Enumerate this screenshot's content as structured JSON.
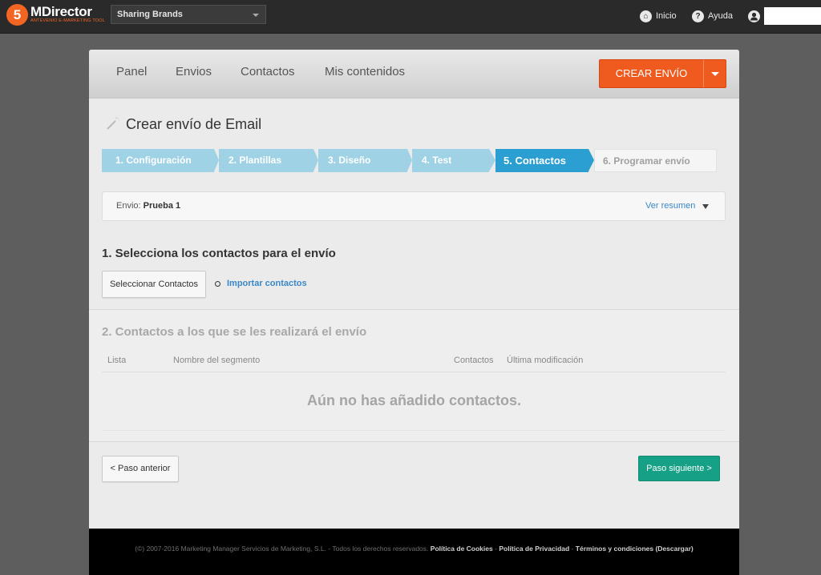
{
  "topbar": {
    "logo": {
      "badge": "5",
      "name": "MDirector",
      "tagline": "ANTEVENIO E-MARKETING TOOL"
    },
    "brand_select": {
      "value": "Sharing Brands"
    },
    "nav": [
      {
        "label": "Inicio",
        "icon": "home-icon",
        "glyph": "⌂"
      },
      {
        "label": "Ayuda",
        "icon": "help-icon",
        "glyph": "?"
      }
    ],
    "user_icon": "user-icon"
  },
  "header": {
    "nav": [
      "Panel",
      "Envios",
      "Contactos",
      "Mis contenidos"
    ],
    "create_button": "CREAR ENVÍO"
  },
  "page": {
    "title": "Crear envío de Email",
    "steps": [
      {
        "label": "1. Configuración",
        "state": "done"
      },
      {
        "label": "2. Plantillas",
        "state": "done"
      },
      {
        "label": "3. Diseño",
        "state": "done"
      },
      {
        "label": "4. Test",
        "state": "done"
      },
      {
        "label": "5. Contactos",
        "state": "active"
      },
      {
        "label": "6. Programar envío",
        "state": "pending"
      }
    ],
    "summary": {
      "label": "Envio:",
      "value": "Prueba 1",
      "toggle": "Ver resumen"
    },
    "section1": {
      "title": "1. Selecciona los contactos para el envío",
      "select_button": "Seleccionar Contactos",
      "import_link": "Importar contactos"
    },
    "section2": {
      "title": "2. Contactos a los que se les realizará el envío",
      "columns": [
        "Lista",
        "Nombre del segmento",
        "Contactos",
        "Última modificación"
      ],
      "empty_message": "Aún no has añadido contactos."
    },
    "prev_button": "< Paso anterior",
    "next_button": "Paso siguiente >"
  },
  "footer": {
    "copyright": "(©) 2007-2016 Marketing Manager Servicios de Marketing, S.L. - Todos los derechos reservados.",
    "links": [
      "Política de Cookies",
      "Política de Privacidad",
      "Términos y condiciones (Descargar)"
    ],
    "separator": "-"
  },
  "colors": {
    "accent_orange": "#ef5a1f",
    "step_active": "#2b9ed2",
    "step_done": "#9fd2e4",
    "next_green": "#16a085",
    "link_blue": "#3a87c8"
  }
}
